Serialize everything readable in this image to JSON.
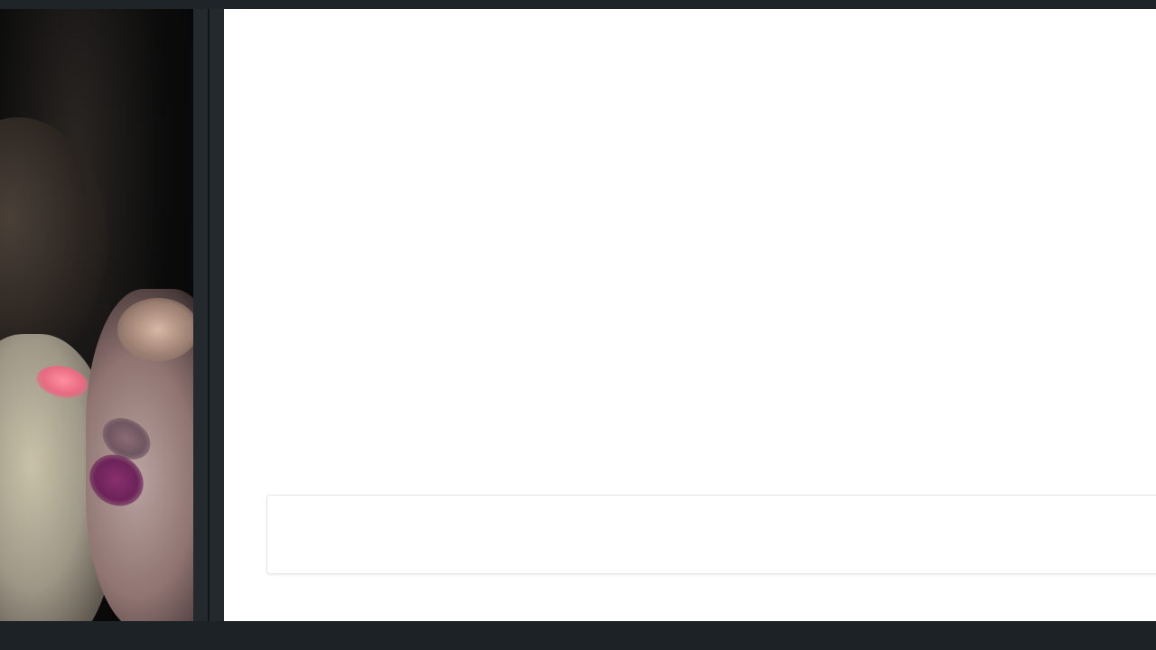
{
  "video": {
    "stream_present": true
  },
  "chat": {
    "messages": [],
    "input_value": "",
    "input_placeholder": ""
  },
  "colors": {
    "frame": "#1d2226",
    "divider": "#24292d",
    "chat_background": "#ffffff",
    "input_border": "#e6e6e6"
  }
}
